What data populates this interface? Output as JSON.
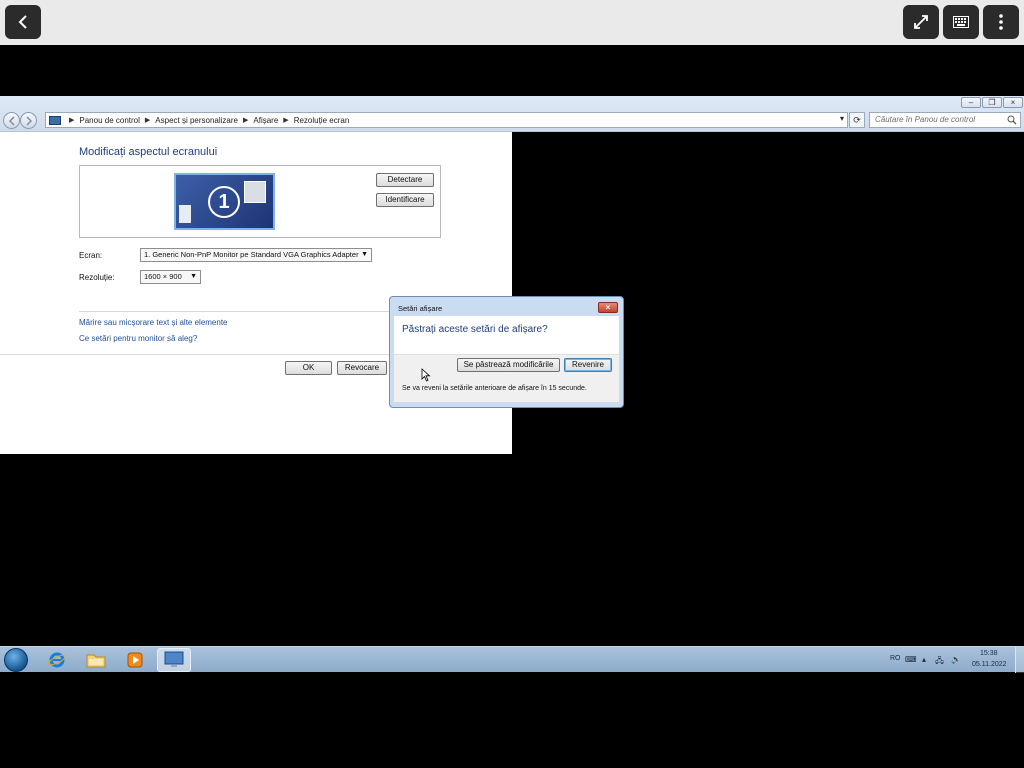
{
  "address": {
    "crumbs": [
      "Panou de control",
      "Aspect și personalizare",
      "Afișare",
      "Rezoluție ecran"
    ]
  },
  "search": {
    "placeholder": "Căutare în Panou de control"
  },
  "content": {
    "title": "Modificați aspectul ecranului",
    "detect_label": "Detectare",
    "identify_label": "Identificare",
    "monitor_number": "1",
    "screen_label": "Ecran:",
    "screen_value": "1. Generic Non-PnP Monitor pe Standard VGA Graphics Adapter",
    "resolution_label": "Rezoluție:",
    "resolution_value": "1600 × 900",
    "link_text_size": "Mărire sau micșorare text și alte elemente",
    "link_monitor": "Ce setări pentru monitor să aleg?",
    "ok_label": "OK",
    "cancel_label": "Revocare"
  },
  "dialog": {
    "title": "Setări afișare",
    "question": "Păstrați aceste setări de afișare?",
    "keep_label": "Se păstrează modificările",
    "revert_label": "Revenire",
    "note": "Se va reveni la setările anterioare de afișare în 15 secunde."
  },
  "taskbar": {
    "language": "RO",
    "time": "15:38",
    "date": "05.11.2022"
  },
  "icons": {
    "viewer": [
      "back-icon",
      "fullscreen-icon",
      "keyboard-icon",
      "more-vert-icon"
    ],
    "taskbar": [
      "windows-start-icon",
      "internet-explorer-icon",
      "folder-icon",
      "media-player-icon",
      "display-icon"
    ]
  },
  "colors": {
    "accent_blue": "#1e3d80",
    "link_blue": "#1f4f9c",
    "taskbar": "#a9c2dc"
  }
}
